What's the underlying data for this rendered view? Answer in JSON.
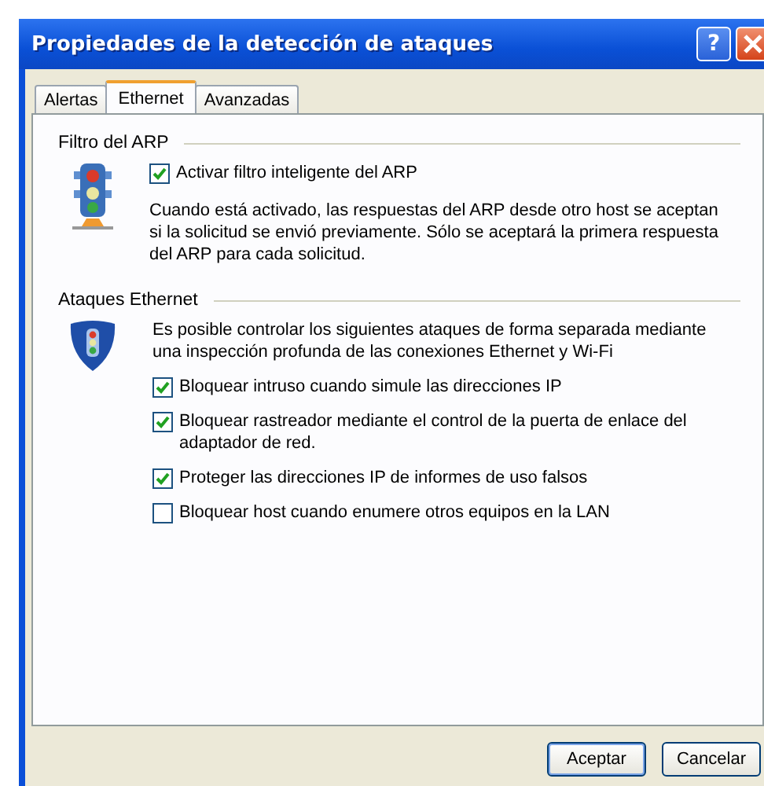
{
  "window": {
    "title": "Propiedades de la detección de ataques",
    "help": "?"
  },
  "tabs": [
    {
      "label": "Alertas",
      "selected": false
    },
    {
      "label": "Ethernet",
      "selected": true
    },
    {
      "label": "Avanzadas",
      "selected": false
    }
  ],
  "arp_filter": {
    "heading": "Filtro del ARP",
    "option": {
      "label": "Activar filtro inteligente del ARP",
      "checked": true
    },
    "description": "Cuando está activado, las respuestas del ARP desde otro host se aceptan si la solicitud se envió previamente. Sólo se aceptará la primera respuesta del ARP para cada solicitud."
  },
  "ethernet_attacks": {
    "heading": "Ataques Ethernet",
    "description": "Es posible controlar los siguientes ataques de forma separada mediante una inspección profunda de las conexiones Ethernet y Wi-Fi",
    "options": [
      {
        "label": "Bloquear intruso cuando simule las direcciones IP",
        "checked": true
      },
      {
        "label": "Bloquear rastreador mediante el control de la puerta de enlace del adaptador de red.",
        "checked": true
      },
      {
        "label": "Proteger las direcciones IP de informes de uso falsos",
        "checked": true
      },
      {
        "label": "Bloquear host cuando enumere otros equipos en la LAN",
        "checked": false
      }
    ]
  },
  "buttons": [
    "Aceptar",
    "Cancelar"
  ]
}
